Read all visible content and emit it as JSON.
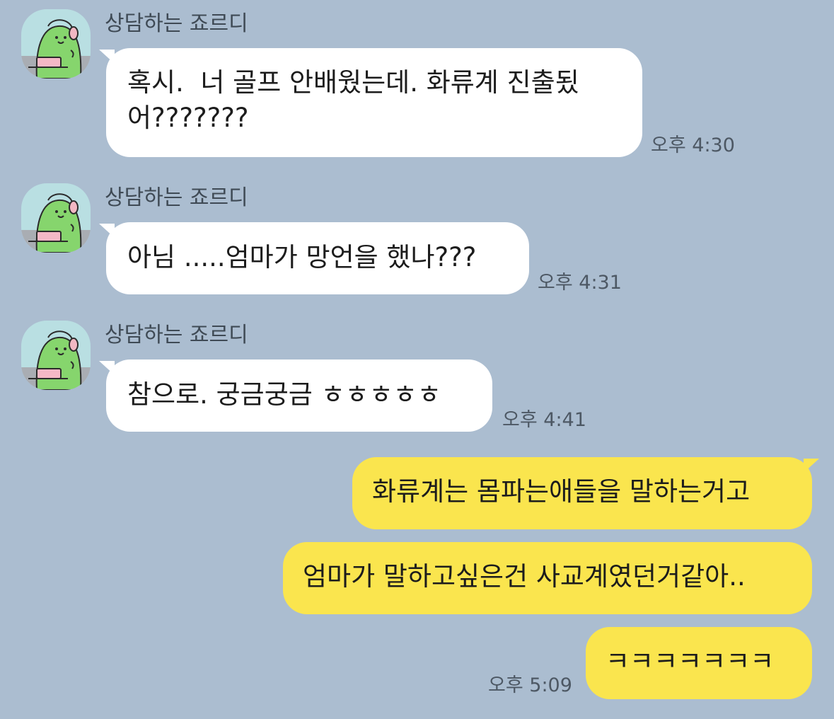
{
  "chat": {
    "sender_name": "상담하는 죠르디",
    "avatar_icon": "jordy-character-icon",
    "incoming_bubble_color": "#ffffff",
    "outgoing_bubble_color": "#fae54e",
    "background_color": "#abbdd0",
    "messages": [
      {
        "direction": "incoming",
        "text": "혹시.  너 골프 안배웠는데. 화류계 진출됬\n어???????",
        "time": "오후 4:30"
      },
      {
        "direction": "incoming",
        "text": "아님 .....엄마가 망언을 했나???",
        "time": "오후 4:31"
      },
      {
        "direction": "incoming",
        "text": "참으로. 궁금궁금 ㅎㅎㅎㅎㅎ",
        "time": "오후 4:41"
      },
      {
        "direction": "outgoing",
        "text": "화류계는 몸파는애들을 말하는거고",
        "time": ""
      },
      {
        "direction": "outgoing",
        "text": "엄마가 말하고싶은건 사교계였던거같아..",
        "time": ""
      },
      {
        "direction": "outgoing",
        "text": "ㅋㅋㅋㅋㅋㅋㅋ",
        "time": "오후 5:09"
      }
    ]
  }
}
